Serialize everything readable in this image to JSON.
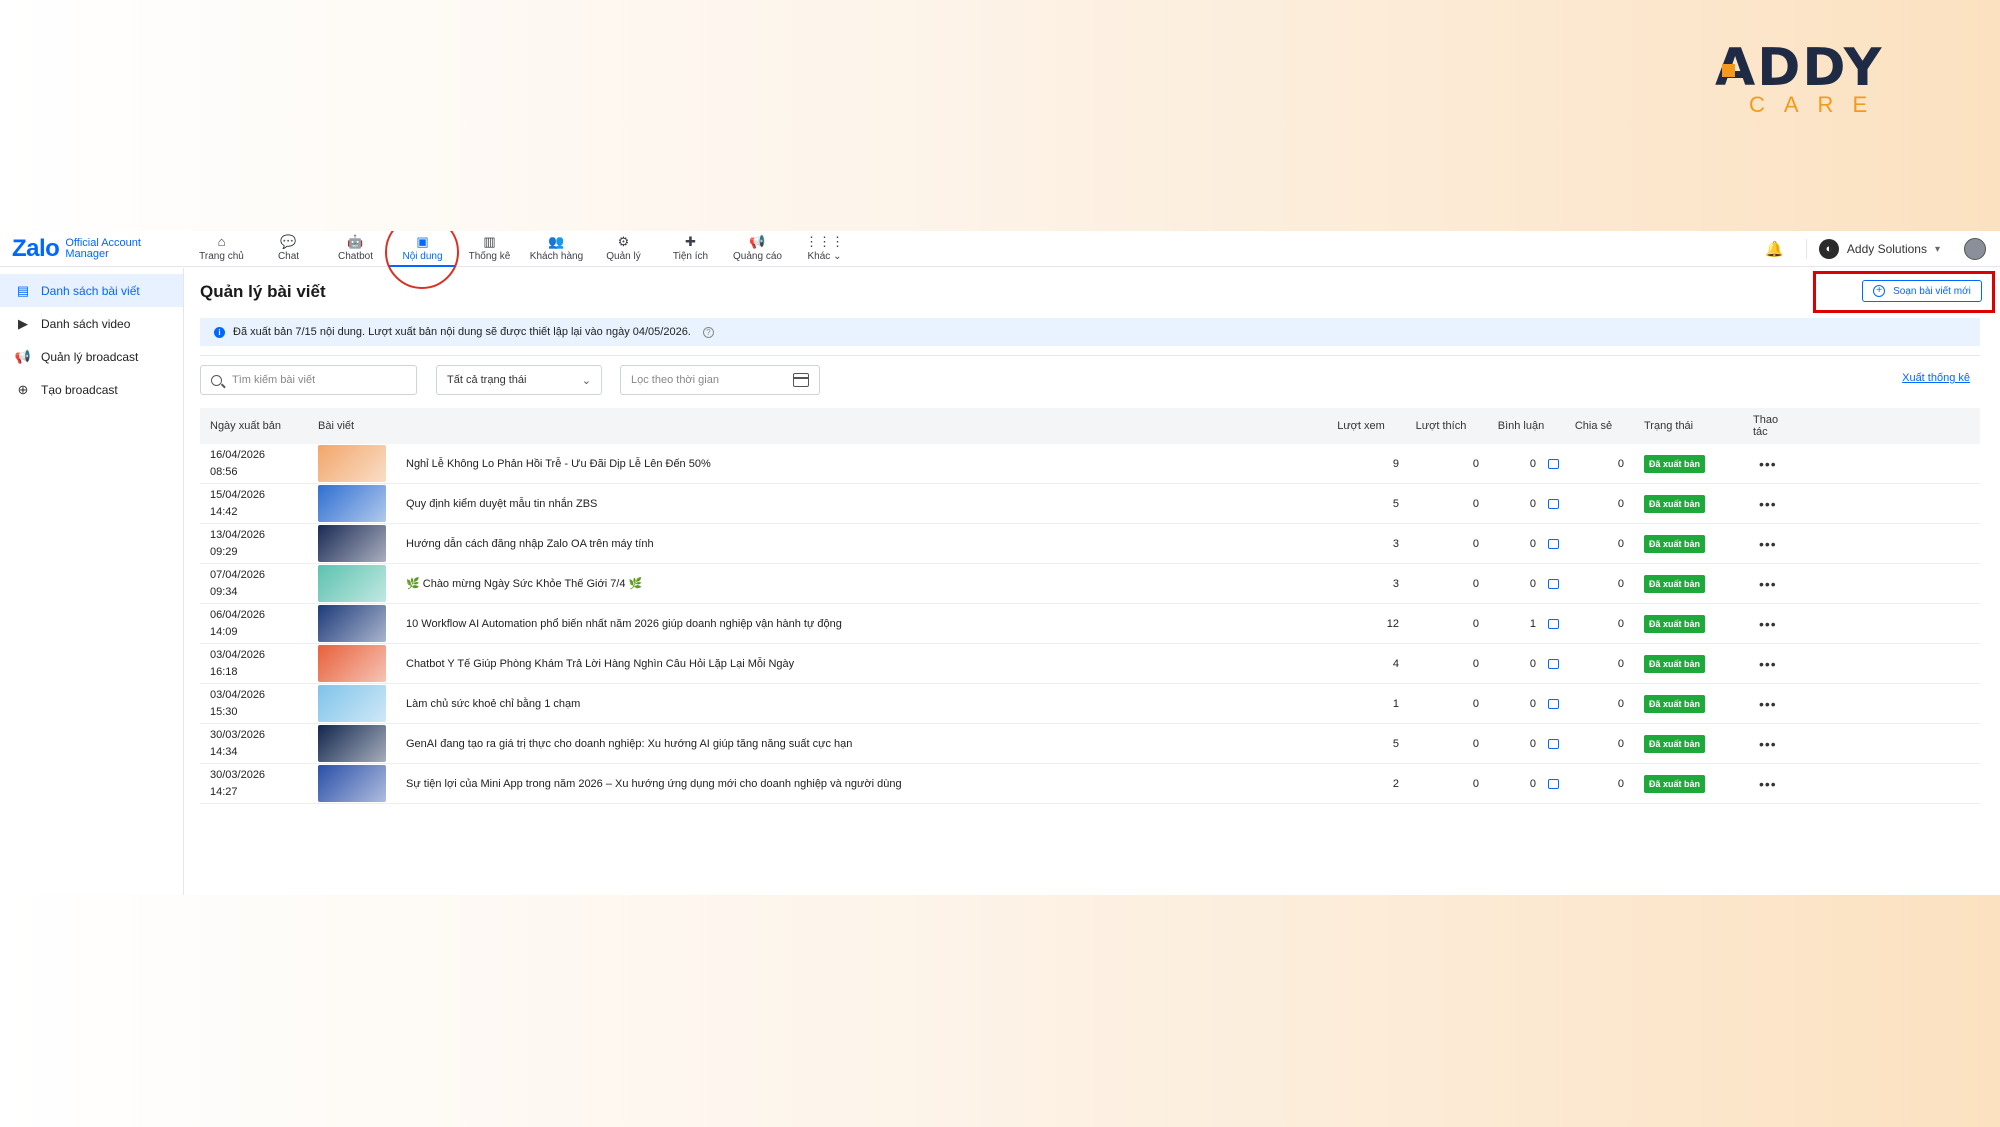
{
  "brand": {
    "top": "ADDY",
    "bottom": "CARE"
  },
  "app": {
    "logo": {
      "word": "Zalo",
      "sub1": "Official Account",
      "sub2": "Manager"
    },
    "nav": [
      {
        "label": "Trang chủ",
        "icon": "home-icon",
        "glyph": "⌂"
      },
      {
        "label": "Chat",
        "icon": "chat-icon",
        "glyph": "💬"
      },
      {
        "label": "Chatbot",
        "icon": "chatbot-icon",
        "glyph": "🤖"
      },
      {
        "label": "Nội dung",
        "icon": "content-icon",
        "glyph": "▣",
        "active": true
      },
      {
        "label": "Thống kê",
        "icon": "stats-icon",
        "glyph": "▥"
      },
      {
        "label": "Khách hàng",
        "icon": "customers-icon",
        "glyph": "👥"
      },
      {
        "label": "Quản lý",
        "icon": "manage-icon",
        "glyph": "⚙"
      },
      {
        "label": "Tiện ích",
        "icon": "utilities-icon",
        "glyph": "✚"
      },
      {
        "label": "Quảng cáo",
        "icon": "ads-icon",
        "glyph": "📢"
      },
      {
        "label": "Khác",
        "icon": "more-apps-icon",
        "glyph": "⋮⋮⋮"
      }
    ],
    "account": {
      "name": "Addy Solutions"
    }
  },
  "sidebar": {
    "items": [
      {
        "label": "Danh sách bài viết",
        "icon": "article-list-icon",
        "active": true
      },
      {
        "label": "Danh sách video",
        "icon": "video-icon"
      },
      {
        "label": "Quản lý broadcast",
        "icon": "broadcast-icon"
      },
      {
        "label": "Tạo broadcast",
        "icon": "plus-circle-icon"
      }
    ]
  },
  "main": {
    "title": "Quản lý bài viết",
    "new_post_button": "Soạn bài viết mới",
    "notice": "Đã xuất bản 7/15 nội dung. Lượt xuất bản nội dung sẽ được thiết lập lại vào ngày 04/05/2026.",
    "search_placeholder": "Tìm kiếm bài viết",
    "status_filter": "Tất cả trạng thái",
    "date_filter_placeholder": "Lọc theo thời gian",
    "export_link": "Xuất thống kê",
    "columns": [
      "Ngày xuất bản",
      "Bài viết",
      "Lượt xem",
      "Lượt thích",
      "Bình luận",
      "Chia sẻ",
      "Trạng thái",
      "Thao tác"
    ],
    "rows": [
      {
        "date": "16/04/2026",
        "time": "08:56",
        "title": "Nghỉ Lễ Không Lo Phản Hồi Trễ - Ưu Đãi Dịp Lễ Lên Đến 50%",
        "views": "9",
        "likes": "0",
        "comments": "0",
        "shares": "0",
        "status": "Đã xuất bản",
        "thumb_color": "#f2a66a"
      },
      {
        "date": "15/04/2026",
        "time": "14:42",
        "title": "Quy định kiểm duyệt mẫu tin nhắn ZBS",
        "views": "5",
        "likes": "0",
        "comments": "0",
        "shares": "0",
        "status": "Đã xuất bản",
        "thumb_color": "#2f6fd1"
      },
      {
        "date": "13/04/2026",
        "time": "09:29",
        "title": "Hướng dẫn cách đăng nhập Zalo OA trên máy tính",
        "views": "3",
        "likes": "0",
        "comments": "0",
        "shares": "0",
        "status": "Đã xuất bản",
        "thumb_color": "#1b2a55"
      },
      {
        "date": "07/04/2026",
        "time": "09:34",
        "title": "🌿 Chào mừng Ngày Sức Khỏe Thế Giới 7/4 🌿",
        "views": "3",
        "likes": "0",
        "comments": "0",
        "shares": "0",
        "status": "Đã xuất bản",
        "thumb_color": "#5cc2b0"
      },
      {
        "date": "06/04/2026",
        "time": "14:09",
        "title": "10 Workflow AI Automation phổ biến nhất năm 2026 giúp doanh nghiệp vận hành tự động",
        "views": "12",
        "likes": "0",
        "comments": "1",
        "shares": "0",
        "status": "Đã xuất bản",
        "thumb_color": "#1d3a7a"
      },
      {
        "date": "03/04/2026",
        "time": "16:18",
        "title": "Chatbot Y Tế Giúp Phòng Khám Trả Lời Hàng Nghìn Câu Hỏi Lặp Lại Mỗi Ngày",
        "views": "4",
        "likes": "0",
        "comments": "0",
        "shares": "0",
        "status": "Đã xuất bản",
        "thumb_color": "#e8603a"
      },
      {
        "date": "03/04/2026",
        "time": "15:30",
        "title": "Làm chủ sức khoẻ chỉ bằng 1 chạm",
        "views": "1",
        "likes": "0",
        "comments": "0",
        "shares": "0",
        "status": "Đã xuất bản",
        "thumb_color": "#7fc3ea"
      },
      {
        "date": "30/03/2026",
        "time": "14:34",
        "title": "GenAI đang tạo ra giá trị thực cho doanh nghiệp: Xu hướng AI giúp tăng năng suất cực hạn",
        "views": "5",
        "likes": "0",
        "comments": "0",
        "shares": "0",
        "status": "Đã xuất bản",
        "thumb_color": "#12264d"
      },
      {
        "date": "30/03/2026",
        "time": "14:27",
        "title": "Sự tiện lợi của Mini App trong năm 2026 – Xu hướng ứng dụng mới cho doanh nghiệp và người dùng",
        "views": "2",
        "likes": "0",
        "comments": "0",
        "shares": "0",
        "status": "Đã xuất bản",
        "thumb_color": "#2a4fa8"
      }
    ]
  },
  "colors": {
    "accent": "#0068ff",
    "published": "#1fa93b",
    "highlight": "#d00000"
  }
}
